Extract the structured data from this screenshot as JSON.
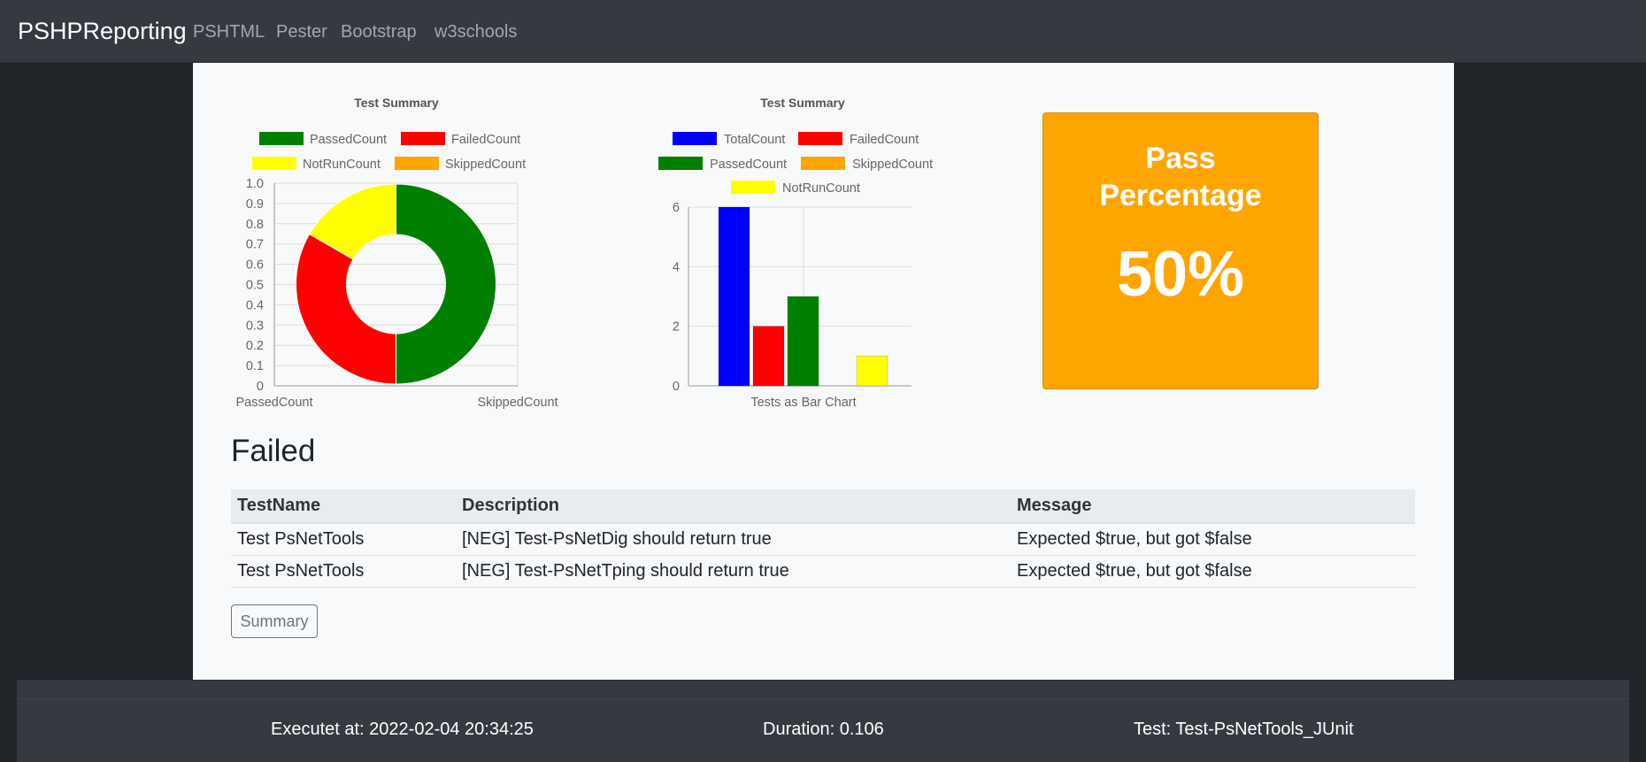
{
  "navbar": {
    "brand": "PSHPReporting",
    "links": [
      "PSHTML",
      "Pester",
      "Bootstrap",
      "w3schools"
    ]
  },
  "colors": {
    "green": "#008000",
    "red": "#ff0000",
    "yellow": "#ffff00",
    "orange": "#ffa500",
    "blue": "#0000ff"
  },
  "pass_percentage": {
    "title": "Pass Percentage",
    "value": "50%"
  },
  "failed": {
    "heading": "Failed",
    "columns": [
      "TestName",
      "Description",
      "Message"
    ],
    "rows": [
      [
        "Test PsNetTools",
        "[NEG] Test-PsNetDig should return true",
        "Expected $true, but got $false"
      ],
      [
        "Test PsNetTools",
        "[NEG] Test-PsNetTping should return true",
        "Expected $true, but got $false"
      ]
    ]
  },
  "summary_button": "Summary",
  "footer": {
    "executed": "Executet at: 2022-02-04 20:34:25",
    "duration": "Duration: 0.106",
    "test": "Test: Test-PsNetTools_JUnit"
  },
  "chart_data": [
    {
      "type": "pie",
      "title": "Test Summary",
      "categories": [
        "PassedCount",
        "FailedCount",
        "NotRunCount",
        "SkippedCount"
      ],
      "values": [
        3,
        2,
        1,
        0
      ],
      "colors": [
        "#008000",
        "#ff0000",
        "#ffff00",
        "#ffa500"
      ],
      "yticks": [
        "0",
        "0.1",
        "0.2",
        "0.3",
        "0.4",
        "0.5",
        "0.6",
        "0.7",
        "0.8",
        "0.9",
        "1.0"
      ],
      "xticks": [
        "PassedCount",
        "SkippedCount"
      ],
      "grid": true,
      "legend": "top"
    },
    {
      "type": "bar",
      "title": "Test Summary",
      "categories": [
        "TotalCount",
        "FailedCount",
        "PassedCount",
        "SkippedCount",
        "NotRunCount"
      ],
      "values": [
        6,
        2,
        3,
        0,
        1
      ],
      "colors": [
        "#0000ff",
        "#ff0000",
        "#008000",
        "#ffa500",
        "#ffff00"
      ],
      "xlabel": "Tests as Bar Chart",
      "yticks": [
        "0",
        "2",
        "4",
        "6"
      ],
      "ylim": [
        0,
        6
      ],
      "grid": true,
      "legend": "top"
    }
  ]
}
